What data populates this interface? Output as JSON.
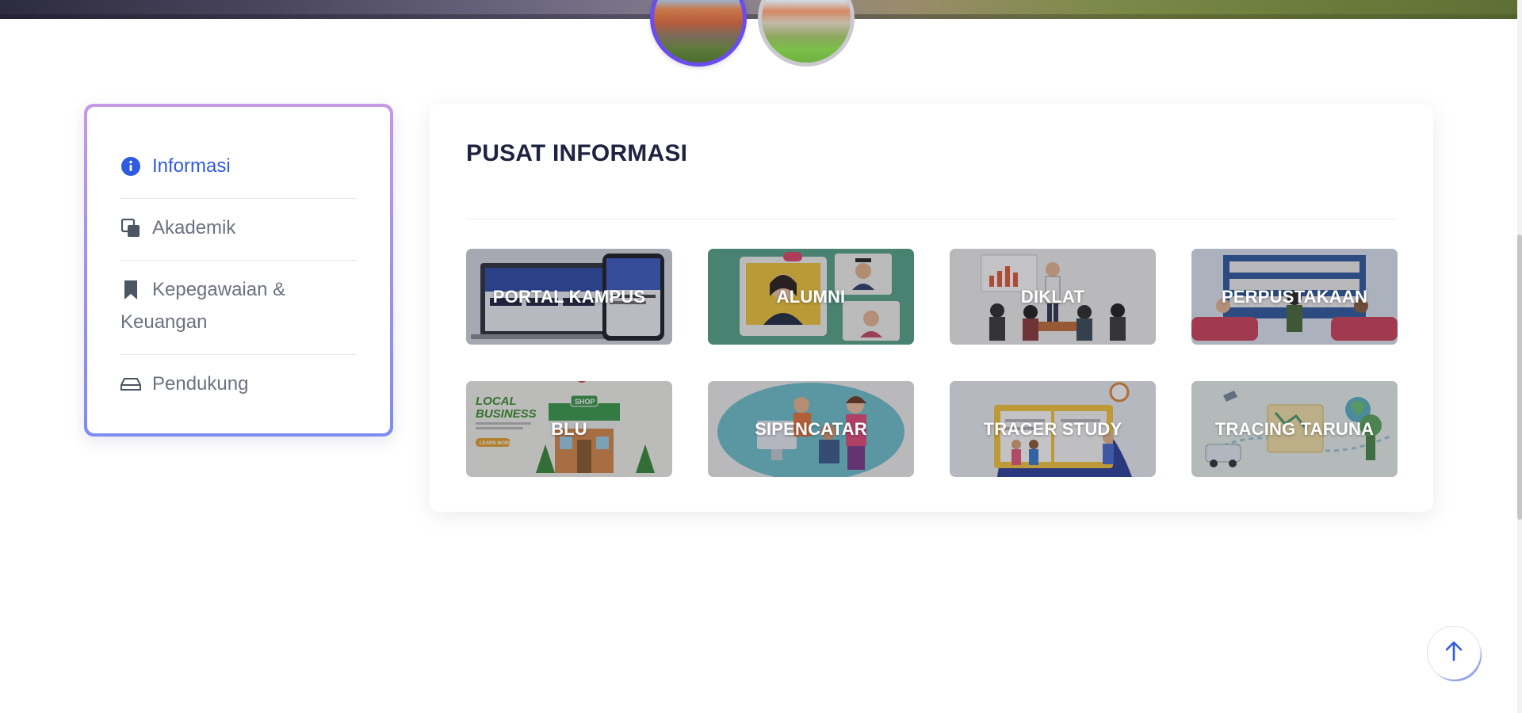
{
  "sidebar": {
    "items": [
      {
        "label": "Informasi",
        "icon": "info-circle-icon",
        "active": true
      },
      {
        "label": "Akademik",
        "icon": "copy-icon",
        "active": false
      },
      {
        "label": "Kepegawaian & Keuangan",
        "icon": "bookmark-icon",
        "active": false
      },
      {
        "label": "Pendukung",
        "icon": "hard-drive-icon",
        "active": false
      }
    ]
  },
  "main": {
    "title": "PUSAT INFORMASI",
    "tiles": [
      {
        "label": "PORTAL KAMPUS"
      },
      {
        "label": "ALUMNI"
      },
      {
        "label": "DIKLAT"
      },
      {
        "label": "PERPUSTAKAAN"
      },
      {
        "label": "BLU"
      },
      {
        "label": "SIPENCATAR"
      },
      {
        "label": "TRACER STUDY"
      },
      {
        "label": "TRACING TARUNA"
      }
    ]
  },
  "tile_art": {
    "portal_kampus": {
      "caption": "LOCAL BUSINESS"
    },
    "blu": {
      "line1": "LOCAL",
      "line2": "BUSINESS",
      "shop": "SHOP",
      "cta": "LEARN MORE"
    }
  },
  "colors": {
    "accent": "#2f5be0",
    "sidebar_border_top": "#c59ae6",
    "sidebar_border_bottom": "#7e8cf0",
    "title": "#1f2340",
    "muted_text": "#6b7280"
  }
}
